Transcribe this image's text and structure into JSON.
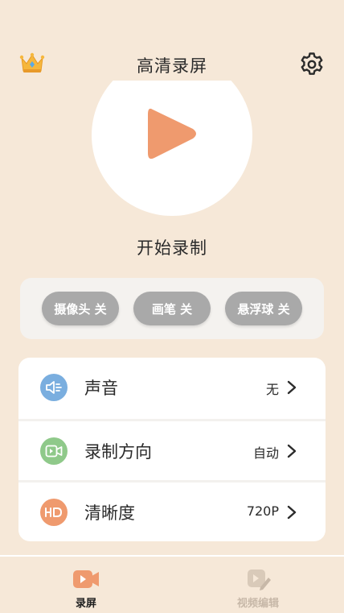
{
  "header": {
    "title": "高清录屏",
    "left_icon": "crown-icon",
    "right_icon": "gear-icon"
  },
  "record": {
    "button_icon": "play-icon",
    "start_label": "开始录制"
  },
  "toggles": [
    {
      "label": "摄像头 关"
    },
    {
      "label": "画笔 关"
    },
    {
      "label": "悬浮球 关"
    }
  ],
  "settings": [
    {
      "icon": "speaker-icon",
      "label": "声音",
      "value": "无",
      "icon_color": "#7aaedf"
    },
    {
      "icon": "video-icon",
      "label": "录制方向",
      "value": "自动",
      "icon_color": "#8fc98a"
    },
    {
      "icon": "hd-icon",
      "label": "清晰度",
      "value": "720P",
      "icon_color": "#ef9a6e"
    }
  ],
  "nav": {
    "items": [
      {
        "label": "录屏",
        "icon": "video-camera-icon",
        "active": true
      },
      {
        "label": "视频编辑",
        "icon": "edit-video-icon",
        "active": false
      }
    ]
  },
  "colors": {
    "background": "#f6e8d8",
    "accent": "#ef9a6e",
    "toggle_off": "#a9a9a9",
    "inactive_nav": "#c7b8a8"
  }
}
